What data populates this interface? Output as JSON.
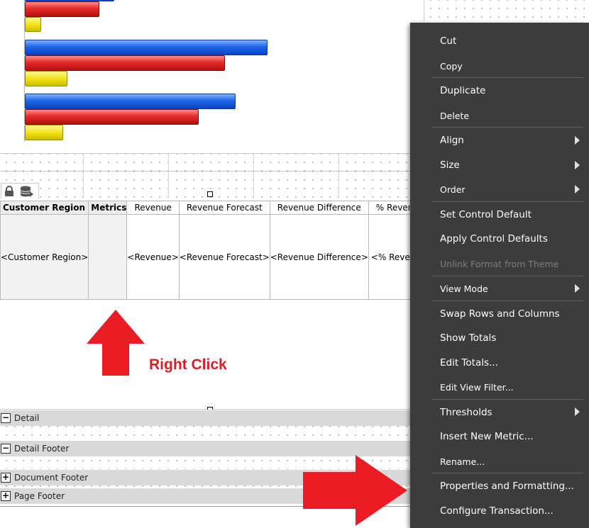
{
  "table": {
    "headers": [
      "Customer Region",
      "Metrics",
      "Revenue",
      "Revenue Forecast",
      "Revenue Difference",
      "% Revenu"
    ],
    "cells": [
      "<Customer Region>",
      "",
      "<Revenue>",
      "<Revenue Forecast>",
      "<Revenue Difference>",
      "<% Revenu"
    ]
  },
  "annotation": {
    "label": "Right Click",
    "color": "#e01b24"
  },
  "sections": [
    "Detail",
    "Detail Footer",
    "Document Footer",
    "Page Footer"
  ],
  "section_toggles": [
    "−",
    "−",
    "+",
    "+"
  ],
  "context_menu": {
    "items": [
      "Cut",
      "Copy",
      "Duplicate",
      "Delete",
      "Align",
      "Size",
      "Order",
      "Set Control Default",
      "Apply Control Defaults",
      "Unlink Format from Theme",
      "View Mode",
      "Swap Rows and Columns",
      "Show Totals",
      "Edit Totals...",
      "Edit View Filter...",
      "Thresholds",
      "Insert New Metric...",
      "Rename...",
      "Properties and Formatting...",
      "Configure Transaction..."
    ]
  },
  "bar_chart": {
    "series_colors": [
      "#1e66e8",
      "#e62b2b",
      "#f3e316"
    ],
    "groups": [
      {
        "values": [
          null,
          103,
          21
        ]
      },
      {
        "values": [
          340,
          280,
          58
        ]
      },
      {
        "values": [
          295,
          243,
          52
        ]
      }
    ]
  },
  "icons": [
    "lock-icon",
    "database-icon"
  ]
}
